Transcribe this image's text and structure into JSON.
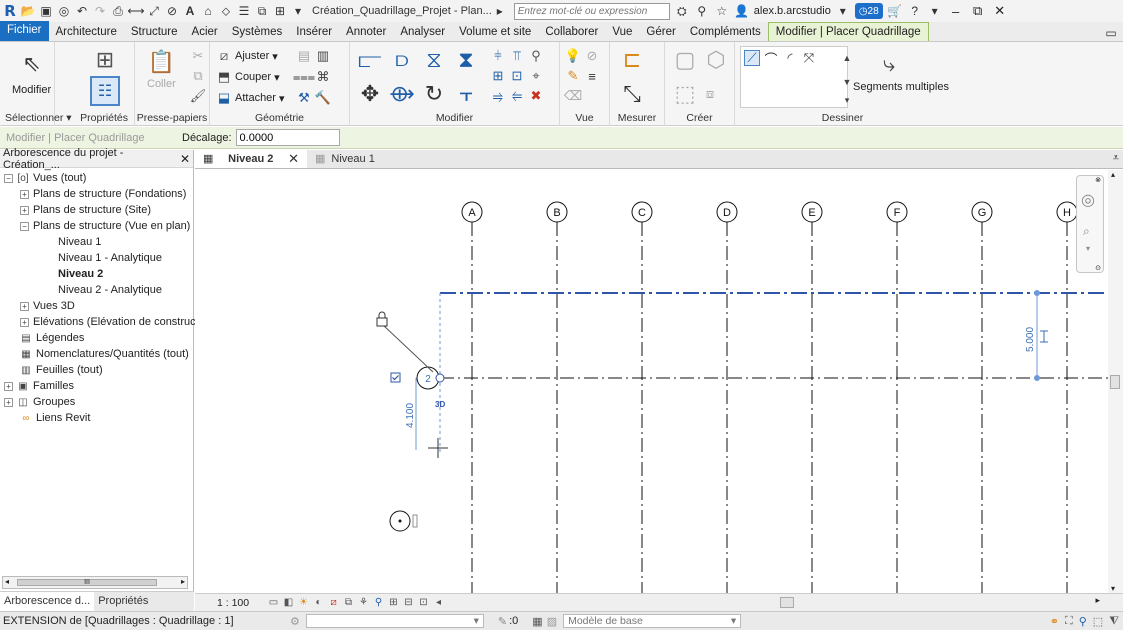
{
  "titlebar": {
    "doc_title": "Création_Quadrillage_Projet - Plan...",
    "search_placeholder": "Entrez mot-clé ou expression",
    "user": "alex.b.arcstudio",
    "notif_count": "28"
  },
  "tabs": [
    {
      "label": "Fichier",
      "kind": "file"
    },
    {
      "label": "Architecture"
    },
    {
      "label": "Structure"
    },
    {
      "label": "Acier"
    },
    {
      "label": "Systèmes"
    },
    {
      "label": "Insérer"
    },
    {
      "label": "Annoter"
    },
    {
      "label": "Analyser"
    },
    {
      "label": "Volume et site"
    },
    {
      "label": "Collaborer"
    },
    {
      "label": "Vue"
    },
    {
      "label": "Gérer"
    },
    {
      "label": "Compléments"
    },
    {
      "label": "Modifier | Placer Quadrillage",
      "kind": "active"
    }
  ],
  "ribbon": {
    "modifier": "Modifier",
    "coller": "Coller",
    "ajuster": "Ajuster",
    "couper": "Couper",
    "attacher": "Attacher",
    "segments_multiples": "Segments multiples",
    "panels": {
      "selectionner": "Sélectionner ▾",
      "proprietes": "Propriétés",
      "presse_papiers": "Presse-papiers",
      "geometrie": "Géométrie",
      "modifier": "Modifier",
      "vue": "Vue",
      "mesurer": "Mesurer",
      "creer": "Créer",
      "dessiner": "Dessiner"
    }
  },
  "options_bar": {
    "context": "Modifier | Placer Quadrillage",
    "offset_label": "Décalage:",
    "offset_value": "0.0000"
  },
  "browser": {
    "title": "Arborescence du projet - Création_...",
    "nodes": [
      {
        "label": "Vues (tout)"
      },
      {
        "label": "Plans de structure (Fondations)"
      },
      {
        "label": "Plans de structure (Site)"
      },
      {
        "label": "Plans de structure (Vue en plan)"
      },
      {
        "label": "Niveau 1"
      },
      {
        "label": "Niveau 1 - Analytique"
      },
      {
        "label": "Niveau 2"
      },
      {
        "label": "Niveau 2 - Analytique"
      },
      {
        "label": "Vues 3D"
      },
      {
        "label": "Elévations (Elévation de construc"
      },
      {
        "label": "Légendes"
      },
      {
        "label": "Nomenclatures/Quantités (tout)"
      },
      {
        "label": "Feuilles (tout)"
      },
      {
        "label": "Familles"
      },
      {
        "label": "Groupes"
      },
      {
        "label": "Liens Revit"
      }
    ],
    "tab_browser": "Arborescence d...",
    "tab_properties": "Propriétés"
  },
  "view_tabs": [
    {
      "label": "Niveau 2",
      "close": "✕"
    },
    {
      "label": "Niveau 1"
    }
  ],
  "canvas": {
    "grid_labels": [
      "A",
      "B",
      "C",
      "D",
      "E",
      "F",
      "G",
      "H"
    ],
    "temp_dim_1": "5.000",
    "temp_dim_2": "4.100",
    "grid_bubble": "2",
    "tag_3d": "3D"
  },
  "view_control": {
    "scale": "1 : 100"
  },
  "status": {
    "text": "EXTENSION de [Quadrillages : Quadrillage : 1]",
    "zero": ":0",
    "model": "Modèle de base"
  },
  "colors": {
    "accent": "#1a6fc2",
    "context_tab": "#e8f2d4",
    "temp_dim": "#3b6fb7"
  }
}
